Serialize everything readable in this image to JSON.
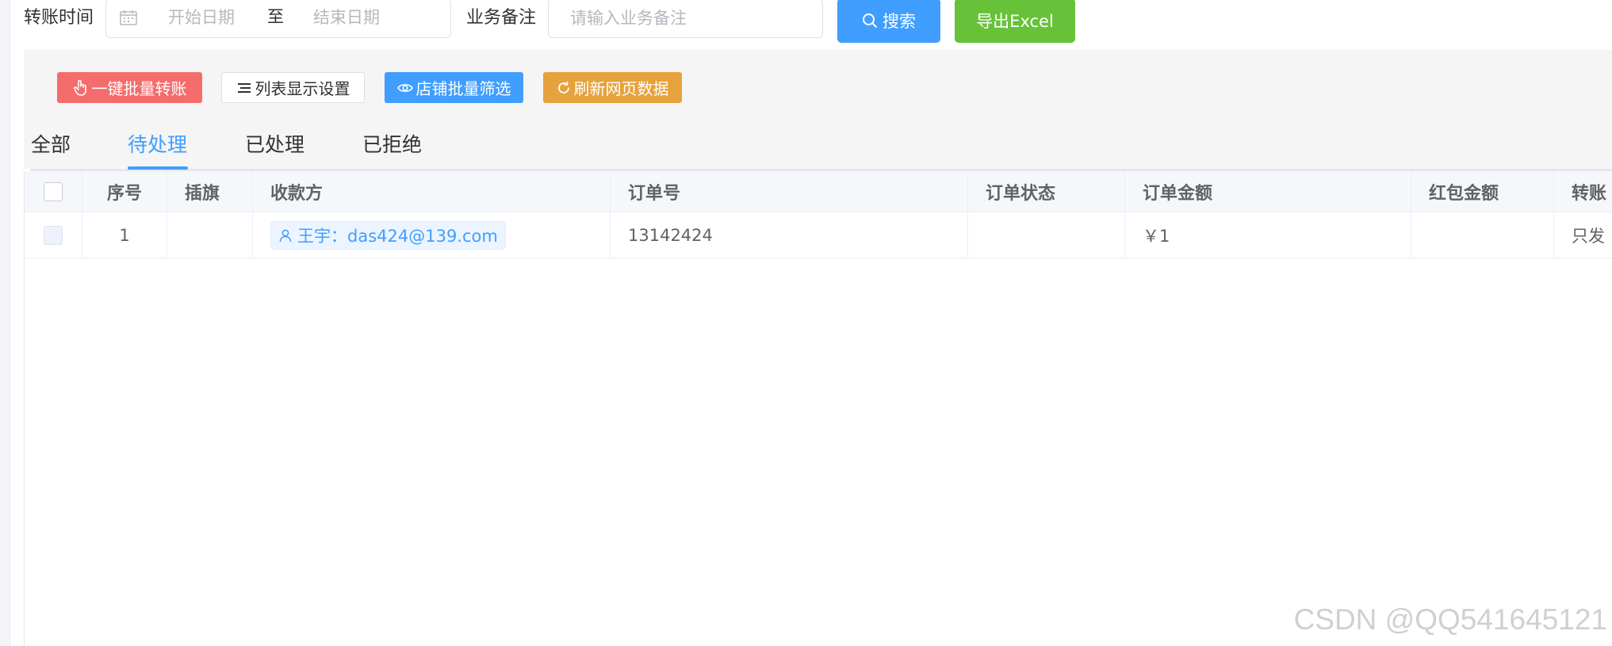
{
  "filters": {
    "transfer_time_label": "转账时间",
    "start_date_placeholder": "开始日期",
    "range_separator": "至",
    "end_date_placeholder": "结束日期",
    "remark_label": "业务备注",
    "remark_placeholder": "请输入业务备注",
    "search_label": "搜索",
    "export_label": "导出Excel"
  },
  "toolbar": {
    "batch_transfer_label": "一键批量转账",
    "column_settings_label": "列表显示设置",
    "shop_filter_label": "店铺批量筛选",
    "refresh_label": "刷新网页数据"
  },
  "tabs": [
    {
      "label": "全部"
    },
    {
      "label": "待处理",
      "active": true
    },
    {
      "label": "已处理"
    },
    {
      "label": "已拒绝"
    }
  ],
  "table": {
    "columns": [
      "序号",
      "插旗",
      "收款方",
      "订单号",
      "订单状态",
      "订单金额",
      "红包金额",
      "转账"
    ],
    "rows": [
      {
        "index": "1",
        "flag": "",
        "payee": "王宇：das424@139.com",
        "order_no": "13142424",
        "order_status": "",
        "order_amount": "￥1",
        "red_packet_amount": "",
        "transfer": "只发"
      }
    ]
  },
  "watermark": "CSDN @QQ541645121",
  "colors": {
    "primary": "#409eff",
    "success": "#67c23a",
    "danger": "#f56c6c",
    "warning": "#e6a23c"
  }
}
